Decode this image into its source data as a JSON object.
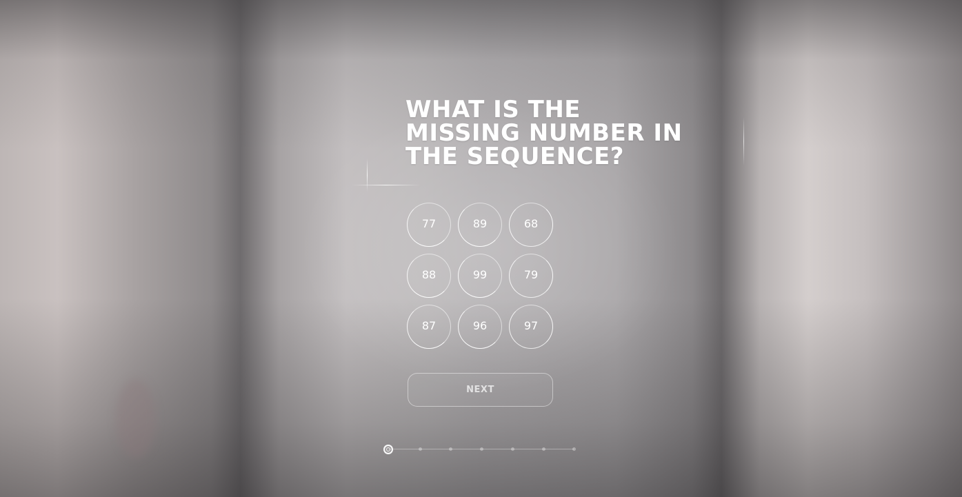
{
  "question": {
    "title": "WHAT IS THE MISSING NUMBER IN THE SEQUENCE?"
  },
  "options": [
    "77",
    "89",
    "68",
    "88",
    "99",
    "79",
    "87",
    "96",
    "97"
  ],
  "next_button": {
    "label": "NEXT"
  },
  "progress": {
    "current_step": 1,
    "total_steps": 7
  }
}
